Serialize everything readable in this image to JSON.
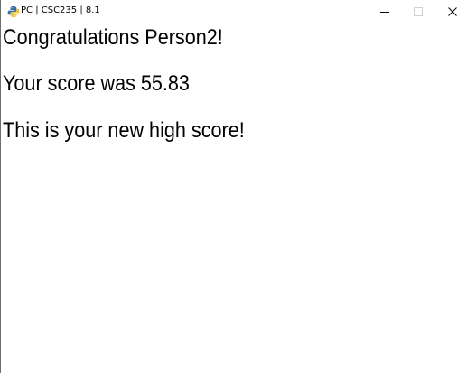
{
  "window": {
    "title": "PC | CSC235 | 8.1",
    "app_icon": "python-icon",
    "controls": {
      "minimize_icon": "minimize-icon",
      "maximize_icon": "maximize-icon",
      "close_icon": "close-icon"
    }
  },
  "content": {
    "congrats_text": "Congratulations Person2!",
    "score_text": "Your score was 55.83",
    "high_score_text": "This is your new high score!"
  },
  "colors": {
    "background": "#ffffff",
    "text": "#000000"
  }
}
